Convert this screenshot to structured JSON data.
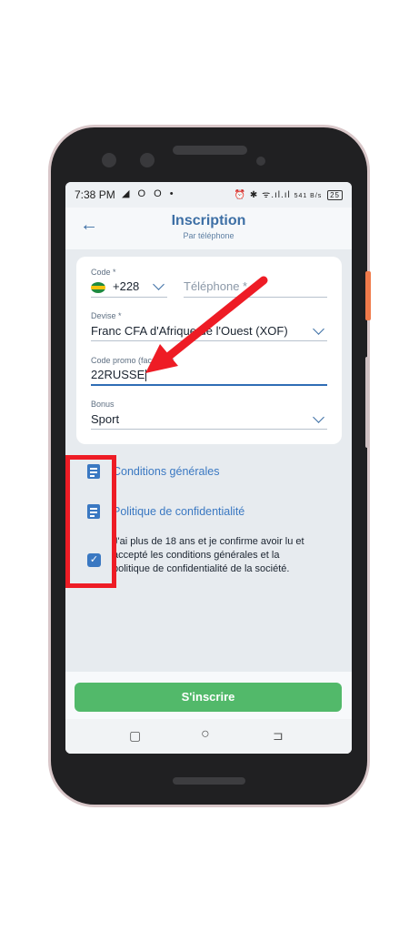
{
  "status_bar": {
    "time": "7:38 PM",
    "left_icons": "◢ O O •",
    "right_icons": "⏰ ✱ ᯤ.ıl.ıl",
    "speed": "541 B/s",
    "battery": "25"
  },
  "appbar": {
    "back_icon": "arrow-left-icon",
    "title": "Inscription",
    "subtitle": "Par téléphone"
  },
  "form": {
    "code_label": "Code *",
    "code_value": "+228",
    "phone_placeholder": "Téléphone *",
    "currency_label": "Devise *",
    "currency_value": "Franc CFA d'Afrique de l'Ouest (XOF)",
    "promo_label": "Code promo (facultatif)",
    "promo_value": "22RUSSE",
    "bonus_label": "Bonus",
    "bonus_value": "Sport"
  },
  "terms": {
    "conditions": "Conditions générales",
    "privacy": "Politique de confidentialité",
    "agree": "J'ai plus de 18 ans et je confirme avoir lu et accepté les conditions générales et la politique de confidentialité de la société."
  },
  "footer": {
    "submit": "S'inscrire"
  },
  "nav": {
    "recents": "▢",
    "home": "○",
    "back": "⊐"
  },
  "colors": {
    "accent": "#3a78c2",
    "button": "#52b96a",
    "annotation": "#ee1c25"
  }
}
